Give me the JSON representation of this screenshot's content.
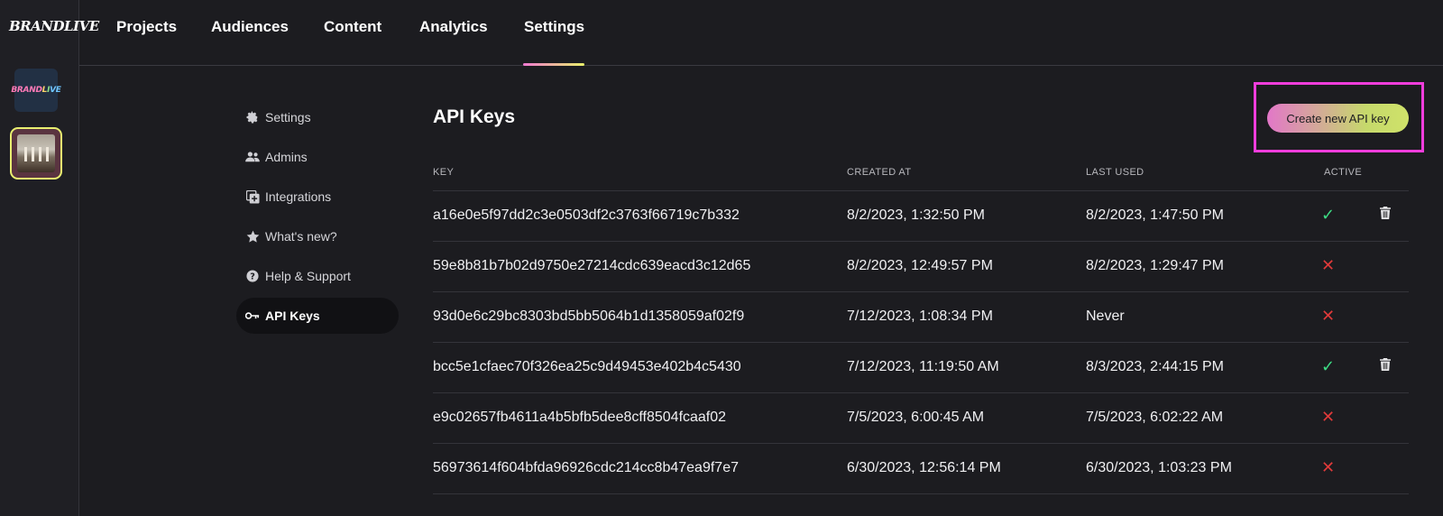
{
  "brand": {
    "logo_text": "BRANDLIVE",
    "tile_text": [
      "BRAND",
      "L",
      "I",
      "VE"
    ]
  },
  "topnav": {
    "items": [
      {
        "label": "Projects"
      },
      {
        "label": "Audiences"
      },
      {
        "label": "Content"
      },
      {
        "label": "Analytics"
      },
      {
        "label": "Settings",
        "active": true
      }
    ]
  },
  "menu": {
    "items": [
      {
        "label": "Settings",
        "icon": "gear-icon"
      },
      {
        "label": "Admins",
        "icon": "users-icon"
      },
      {
        "label": "Integrations",
        "icon": "integrations-icon"
      },
      {
        "label": "What's new?",
        "icon": "star-icon"
      },
      {
        "label": "Help & Support",
        "icon": "help-icon"
      },
      {
        "label": "API Keys",
        "icon": "key-icon",
        "active": true
      }
    ]
  },
  "page": {
    "title": "API Keys",
    "create_button": "Create new API key"
  },
  "table": {
    "columns": [
      "KEY",
      "CREATED AT",
      "LAST USED",
      "ACTIVE"
    ],
    "rows": [
      {
        "key": "a16e0e5f97dd2c3e0503df2c3763f66719c7b332",
        "created": "8/2/2023, 1:32:50 PM",
        "last_used": "8/2/2023, 1:47:50 PM",
        "active": true
      },
      {
        "key": "59e8b81b7b02d9750e27214cdc639eacd3c12d65",
        "created": "8/2/2023, 12:49:57 PM",
        "last_used": "8/2/2023, 1:29:47 PM",
        "active": false
      },
      {
        "key": "93d0e6c29bc8303bd5bb5064b1d1358059af02f9",
        "created": "7/12/2023, 1:08:34 PM",
        "last_used": "Never",
        "active": false
      },
      {
        "key": "bcc5e1cfaec70f326ea25c9d49453e402b4c5430",
        "created": "7/12/2023, 11:19:50 AM",
        "last_used": "8/3/2023, 2:44:15 PM",
        "active": true
      },
      {
        "key": "e9c02657fb4611a4b5bfb5dee8cff8504fcaaf02",
        "created": "7/5/2023, 6:00:45 AM",
        "last_used": "7/5/2023, 6:02:22 AM",
        "active": false
      },
      {
        "key": "56973614f604bfda96926cdc214cc8b47ea9f7e7",
        "created": "6/30/2023, 12:56:14 PM",
        "last_used": "6/30/2023, 1:03:23 PM",
        "active": false
      }
    ]
  },
  "colors": {
    "accent_pink": "#f03ddc",
    "check": "#3ddc84",
    "cross": "#e03a3a"
  }
}
